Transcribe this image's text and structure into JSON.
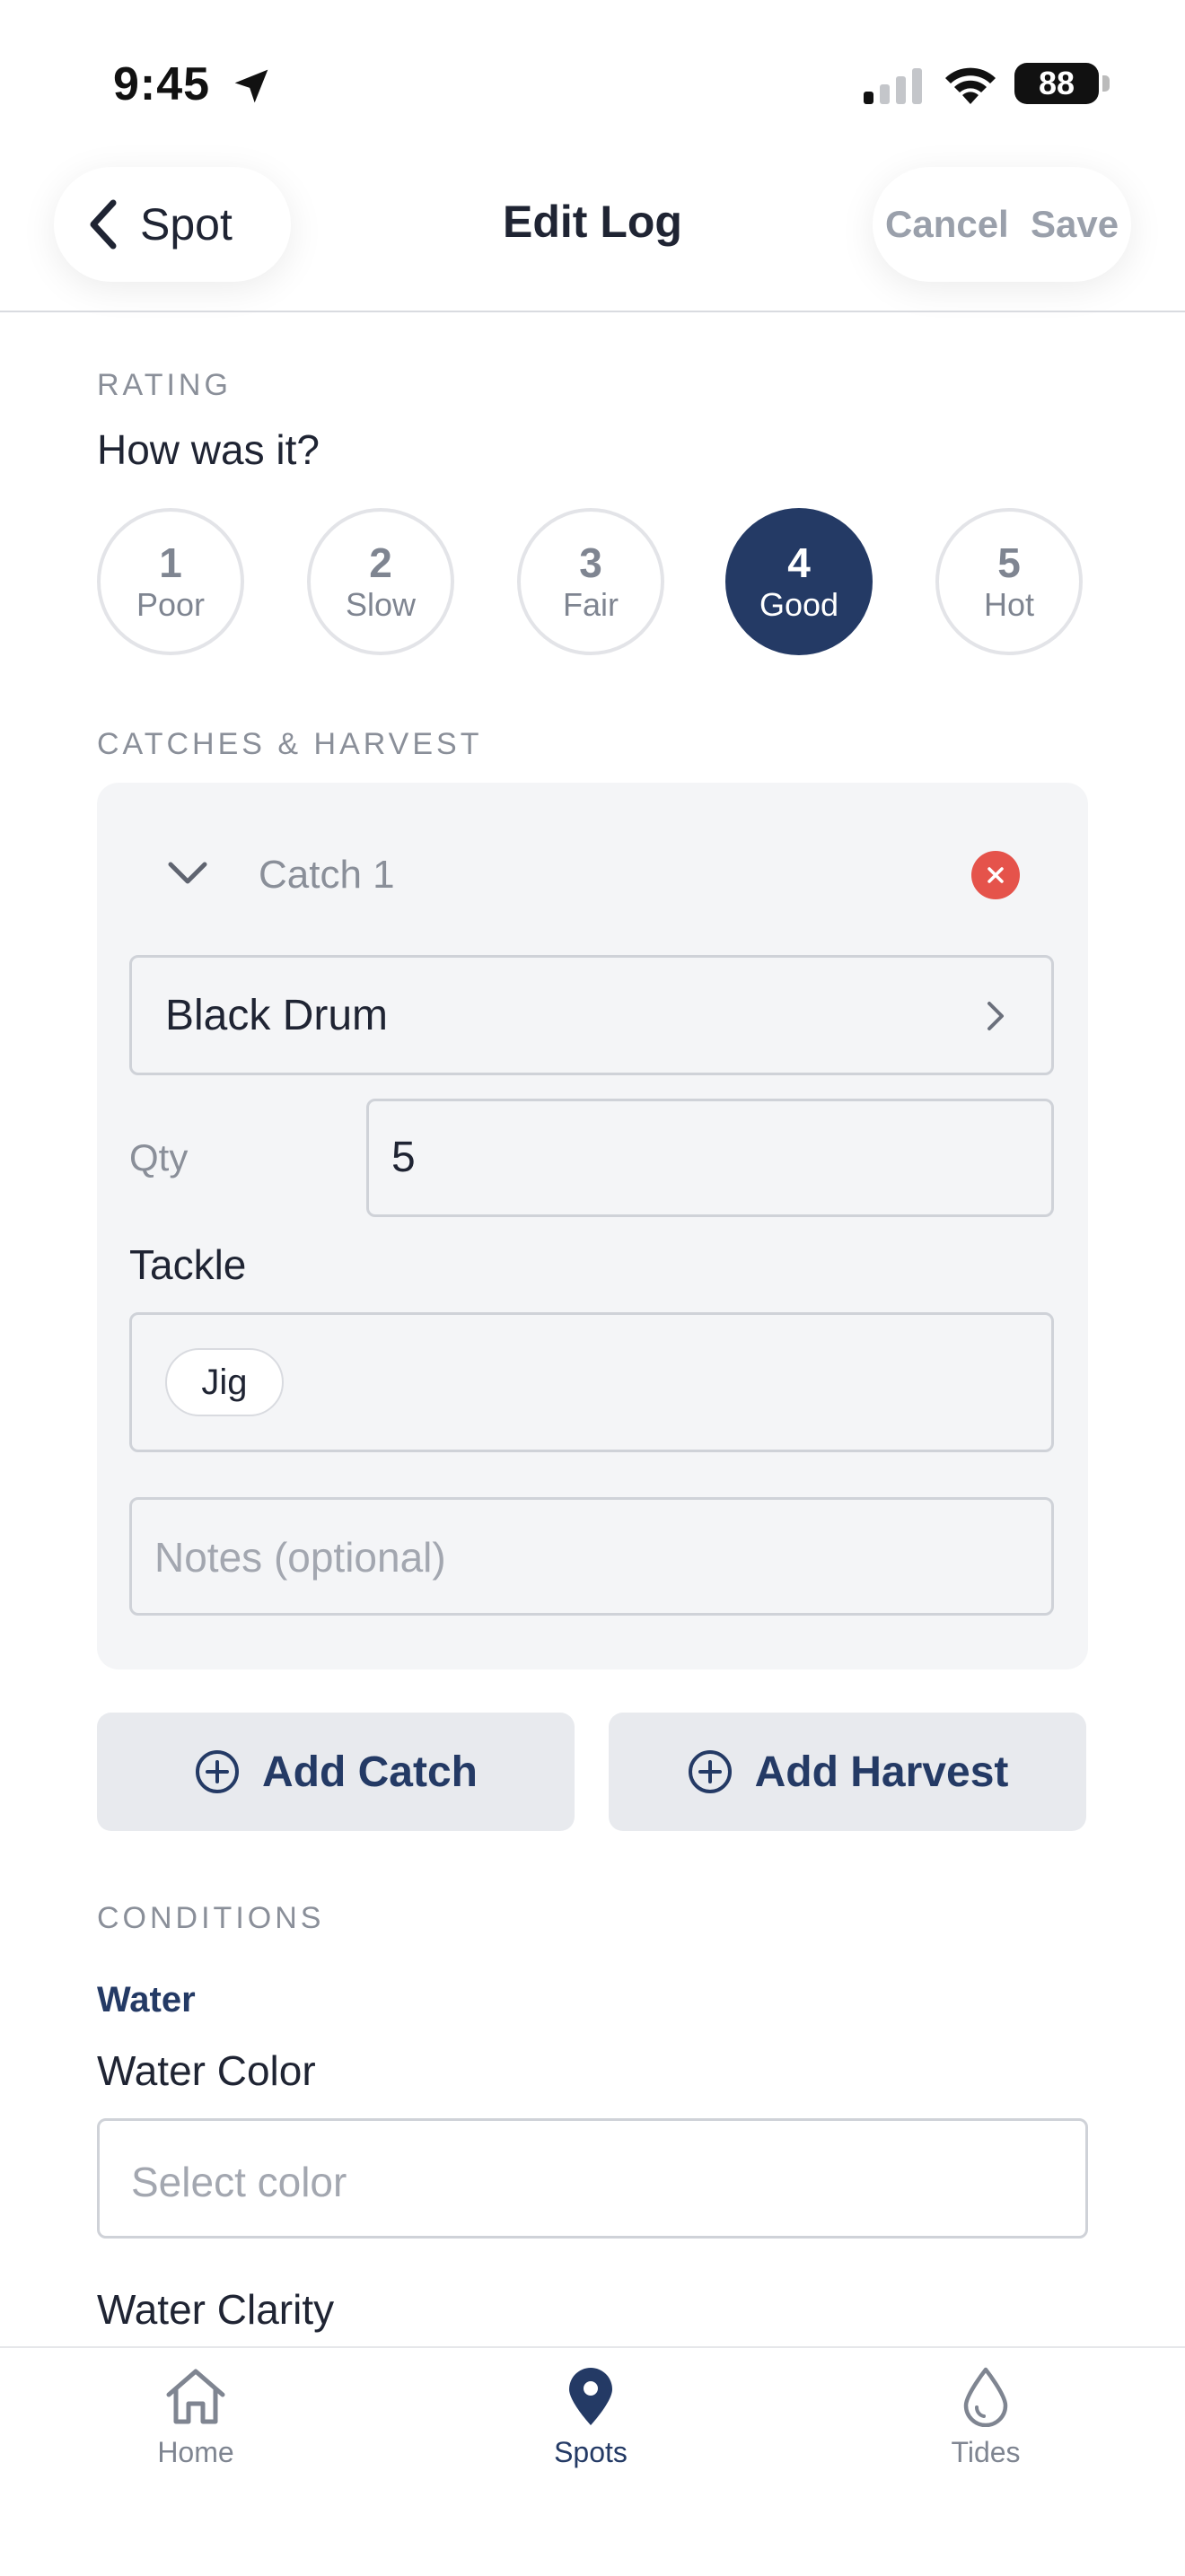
{
  "status_bar": {
    "time": "9:45",
    "battery": "88"
  },
  "nav": {
    "back_label": "Spot",
    "title": "Edit Log",
    "cancel": "Cancel",
    "save": "Save"
  },
  "rating": {
    "section_label": "RATING",
    "question": "How was it?",
    "selected": 4,
    "options": [
      {
        "num": "1",
        "label": "Poor"
      },
      {
        "num": "2",
        "label": "Slow"
      },
      {
        "num": "3",
        "label": "Fair"
      },
      {
        "num": "4",
        "label": "Good"
      },
      {
        "num": "5",
        "label": "Hot"
      }
    ]
  },
  "catches": {
    "section_label": "CATCHES & HARVEST",
    "items": [
      {
        "title": "Catch 1",
        "species": "Black Drum",
        "qty_label": "Qty",
        "qty": "5",
        "tackle_label": "Tackle",
        "tackle": [
          "Jig"
        ],
        "notes_placeholder": "Notes (optional)"
      }
    ],
    "add_catch": "Add Catch",
    "add_harvest": "Add Harvest"
  },
  "conditions": {
    "section_label": "CONDITIONS",
    "water_heading": "Water",
    "water_color_label": "Water Color",
    "water_color_placeholder": "Select color",
    "water_clarity_label": "Water Clarity"
  },
  "tabs": [
    {
      "label": "Home",
      "icon": "home-icon",
      "active": false
    },
    {
      "label": "Spots",
      "icon": "map-pin-icon",
      "active": true
    },
    {
      "label": "Tides",
      "icon": "water-drop-icon",
      "active": false
    }
  ],
  "colors": {
    "accent": "#243a65",
    "danger": "#e5534b",
    "muted": "#8a8f99"
  }
}
